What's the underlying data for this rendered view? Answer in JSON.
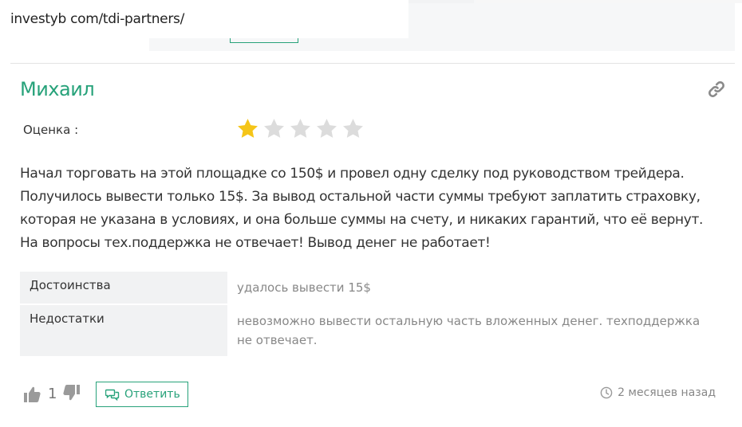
{
  "browser": {
    "url": "investyb com/tdi-partners/"
  },
  "review": {
    "author": "Михаил",
    "rating_label": "Оценка :",
    "rating": 1,
    "rating_max": 5,
    "text": "Начал торговать на этой площадке со 150$ и провел одну сделку под руководством трейдера. Получилось вывести только 15$. За вывод остальной части суммы требуют заплатить страховку, которая не указана в условиях, и она больше суммы на счету, и никаких гарантий, что её вернут. На вопросы тех.поддержка не отвечает! Вывод денег не работает!",
    "pros_label": "Достоинства",
    "pros_value": "удалось вывести 15$",
    "cons_label": "Недостатки",
    "cons_value": "невозможно вывести остальную часть вложенных денег. техподдержка не отвечает.",
    "votes": "1",
    "reply_label": "Ответить",
    "time_ago": "2 месяцев назад"
  },
  "icons": {
    "link": "link-icon",
    "star_filled": "star-filled-icon",
    "star_empty": "star-empty-icon",
    "like": "thumbs-up-icon",
    "dislike": "thumbs-down-icon",
    "reply": "chat-bubbles-icon",
    "clock": "clock-icon"
  },
  "colors": {
    "accent": "#27a27a",
    "star_filled": "#f5c518",
    "star_empty": "#dcdcdc",
    "muted_text": "#888888"
  }
}
